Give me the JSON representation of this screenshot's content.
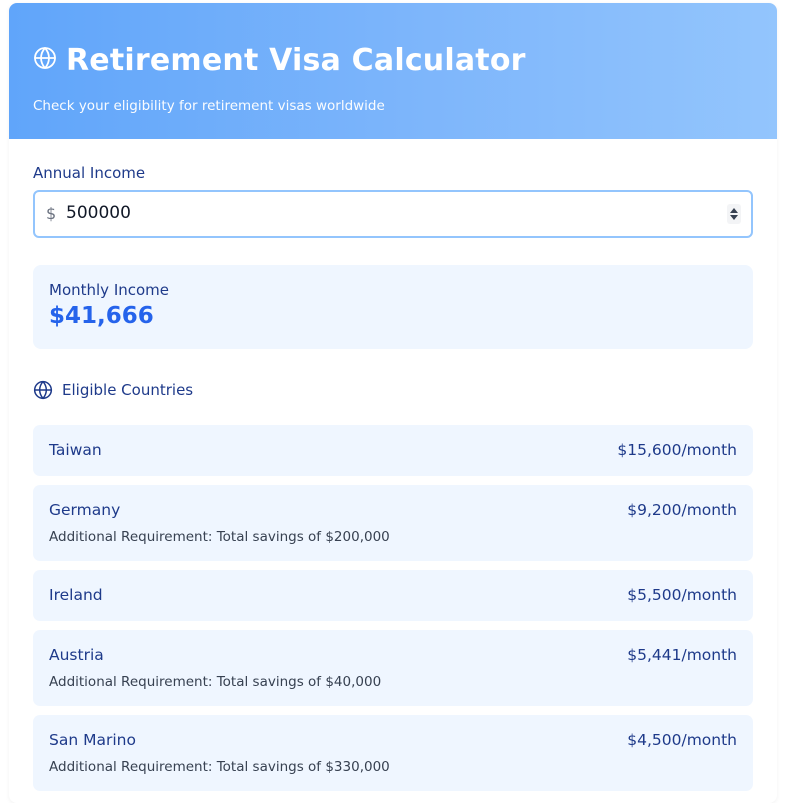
{
  "header": {
    "title": "Retirement Visa Calculator",
    "subtitle": "Check your eligibility for retirement visas worldwide",
    "icon": "globe-icon",
    "gradient_start": "#60a5fa",
    "gradient_end": "#93c5fd"
  },
  "income_field": {
    "label": "Annual Income",
    "currency_symbol": "$",
    "value": "500000"
  },
  "monthly": {
    "label": "Monthly Income",
    "value": "$41,666"
  },
  "eligible": {
    "title": "Eligible Countries",
    "icon": "globe-icon"
  },
  "countries": [
    {
      "name": "Taiwan",
      "amount": "$15,600/month",
      "requirement": ""
    },
    {
      "name": "Germany",
      "amount": "$9,200/month",
      "requirement": "Additional Requirement: Total savings of $200,000"
    },
    {
      "name": "Ireland",
      "amount": "$5,500/month",
      "requirement": ""
    },
    {
      "name": "Austria",
      "amount": "$5,441/month",
      "requirement": "Additional Requirement: Total savings of $40,000"
    },
    {
      "name": "San Marino",
      "amount": "$4,500/month",
      "requirement": "Additional Requirement: Total savings of $330,000"
    }
  ],
  "colors": {
    "accent": "#2563eb",
    "text_dark_blue": "#1e3a8a",
    "panel_bg": "#eff6ff",
    "input_border": "#93c5fd"
  }
}
